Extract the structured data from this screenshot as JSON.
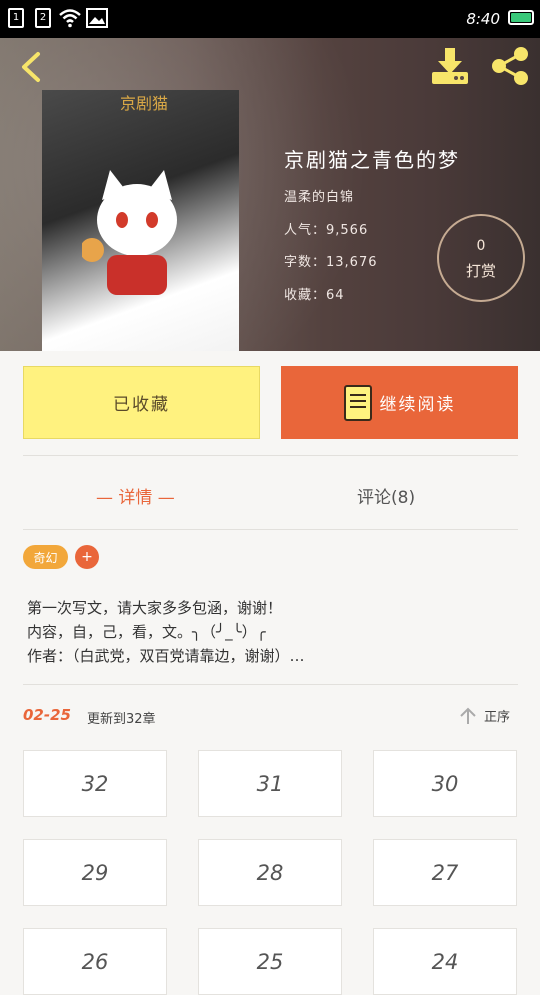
{
  "status_bar": {
    "sim1": "1",
    "sim2": "2",
    "time": "8:40"
  },
  "book": {
    "cover_title": "京剧猫",
    "title": "京剧猫之青色的梦",
    "author": "温柔的白锦",
    "popularity": "人气：9,566",
    "word_count": "字数：13,676",
    "favorites": "收藏：64",
    "reward_count": "0",
    "reward_label": "打赏"
  },
  "actions": {
    "favorited_label": "已收藏",
    "continue_label": "继续阅读"
  },
  "tabs": {
    "details": "— 详情 —",
    "comments": "评论(8)"
  },
  "tags": {
    "genre": "奇幻",
    "add": "+"
  },
  "description": "第一次写文，请大家多多包涵，谢谢！\n内容，自，己，看，文。╮（╯_╰）╭\n作者：（白武党，双百党请靠边，谢谢）…",
  "update": {
    "date": "02-25",
    "text": "更新到32章",
    "sort_label": "正序"
  },
  "chapters": [
    "32",
    "31",
    "30",
    "29",
    "28",
    "27",
    "26",
    "25",
    "24"
  ],
  "colors": {
    "accent": "#e9663a",
    "favorite_button": "#fff27f",
    "genre_tag": "#f2a73a"
  }
}
